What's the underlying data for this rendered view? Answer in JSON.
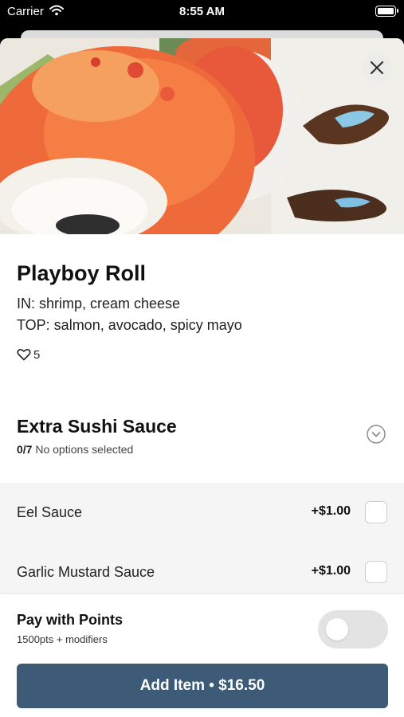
{
  "status_bar": {
    "carrier": "Carrier",
    "time": "8:55 AM"
  },
  "item": {
    "name": "Playboy Roll",
    "description_line1": "IN: shrimp, cream cheese",
    "description_line2": "TOP: salmon, avocado, spicy mayo",
    "likes": "5"
  },
  "modifier_group": {
    "title": "Extra Sushi Sauce",
    "count": "0/7",
    "status": "No options selected",
    "options": [
      {
        "label": "Eel Sauce",
        "price": "+$1.00"
      },
      {
        "label": "Garlic Mustard Sauce",
        "price": "+$1.00"
      }
    ]
  },
  "points": {
    "title": "Pay with Points",
    "subtitle": "1500pts + modifiers"
  },
  "add_button": {
    "label": "Add Item • $16.50"
  },
  "icons": [
    "wifi-icon",
    "battery-icon",
    "close-icon",
    "heart-icon",
    "chevron-down-icon"
  ],
  "colors": {
    "primary_button": "#3d5a77",
    "toggle_off": "#e3e3e3"
  }
}
